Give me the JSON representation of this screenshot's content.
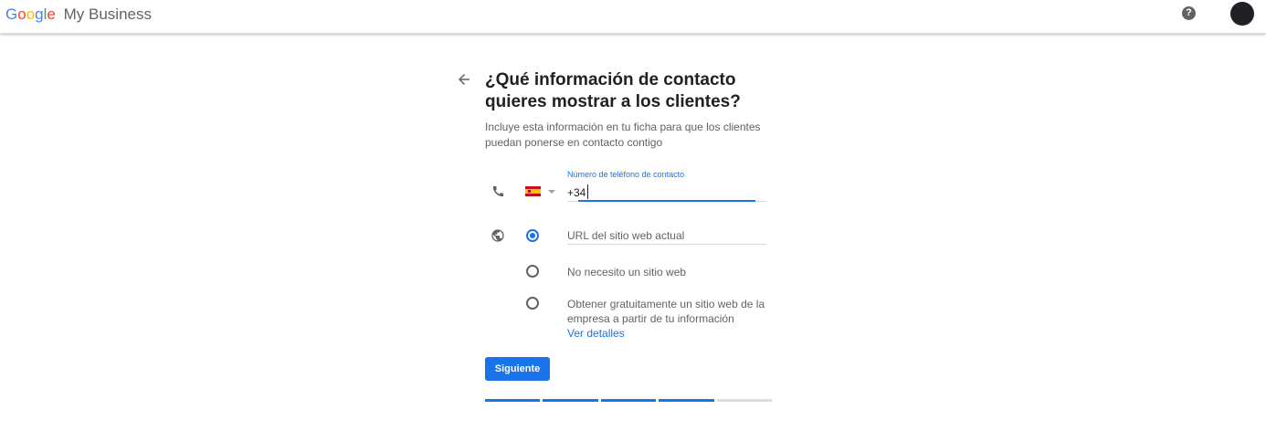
{
  "header": {
    "brand_letters": [
      {
        "char": "G",
        "color": "#4285f4"
      },
      {
        "char": "o",
        "color": "#ea4335"
      },
      {
        "char": "o",
        "color": "#fbbc05"
      },
      {
        "char": "g",
        "color": "#4285f4"
      },
      {
        "char": "l",
        "color": "#34a853"
      },
      {
        "char": "e",
        "color": "#ea4335"
      }
    ],
    "product": "My Business",
    "help_glyph": "?"
  },
  "page": {
    "title": "¿Qué información de contacto quieres mostrar a los clientes?",
    "subtitle": "Incluye esta información en tu ficha para que los clientes puedan ponerse en contacto contigo"
  },
  "phone": {
    "label": "Número de teléfono de contacto",
    "value": "+34",
    "country": "ES"
  },
  "website": {
    "url_placeholder": "URL del sitio web actual",
    "options": [
      {
        "label": "URL del sitio web actual",
        "selected": true
      },
      {
        "label": "No necesito un sitio web",
        "selected": false
      },
      {
        "label": "Obtener gratuitamente un sitio web de la empresa a partir de tu información",
        "selected": false
      }
    ],
    "details_link": "Ver detalles"
  },
  "actions": {
    "next_label": "Siguiente"
  },
  "progress": {
    "total_steps": 5,
    "completed_steps": 4
  },
  "colors": {
    "accent": "#1a73e8",
    "text_primary": "#202124",
    "text_secondary": "#5f6368"
  }
}
